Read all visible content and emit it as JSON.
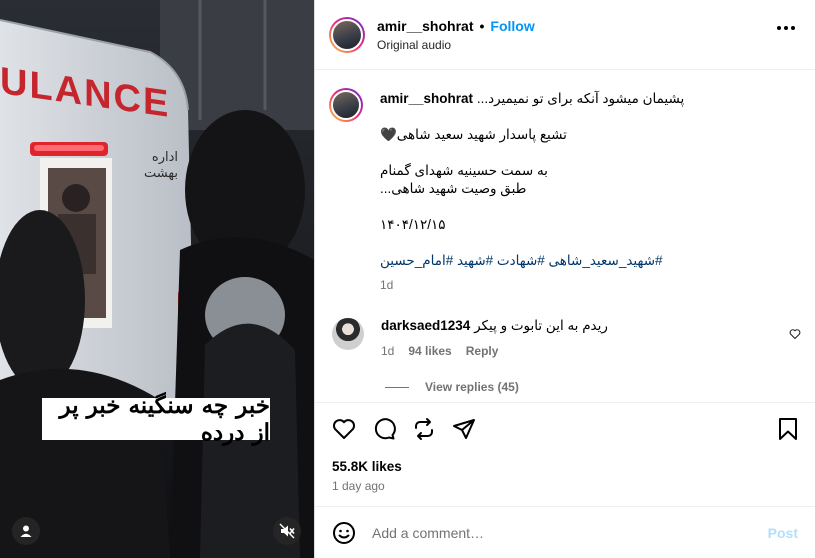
{
  "video": {
    "caption_overlay": "خبر چه سنگینه خبر پر از درده",
    "vehicle_text": "ULANCE",
    "side_text": "اداره بهشت",
    "icons": [
      "user-icon",
      "muted-audio-icon"
    ]
  },
  "header": {
    "username": "amir__shohrat",
    "separator": "•",
    "follow_label": "Follow",
    "audio": "Original audio"
  },
  "caption": {
    "username": "amir__shohrat",
    "line1": "پشیمان میشود آنکه برای تو نمیمیرد...",
    "line2": "تشیع پاسدار شهید سعید شاهی🖤",
    "line3": "به سمت حسینیه شهدای گمنام",
    "line4": "طبق وصیت شهید شاهی...",
    "date": "۱۴۰۴/۱۲/۱۵",
    "hashtags": "#شهید_سعید_شاهی #شهادت #شهید #امام_حسین",
    "time": "1d"
  },
  "comment": {
    "username": "darksaed1234",
    "text": "ریدم به این تابوت و پیکر",
    "time": "1d",
    "likes": "94 likes",
    "reply": "Reply",
    "view_replies": "View replies (45)"
  },
  "actions": {
    "likes": "55.8K likes",
    "ago": "1 day ago"
  },
  "add_comment": {
    "placeholder": "Add a comment…",
    "post_label": "Post"
  },
  "colors": {
    "accent": "#0095f6",
    "hashtag": "#00376b",
    "muted": "#737373",
    "post_disabled": "#b2dffc"
  }
}
